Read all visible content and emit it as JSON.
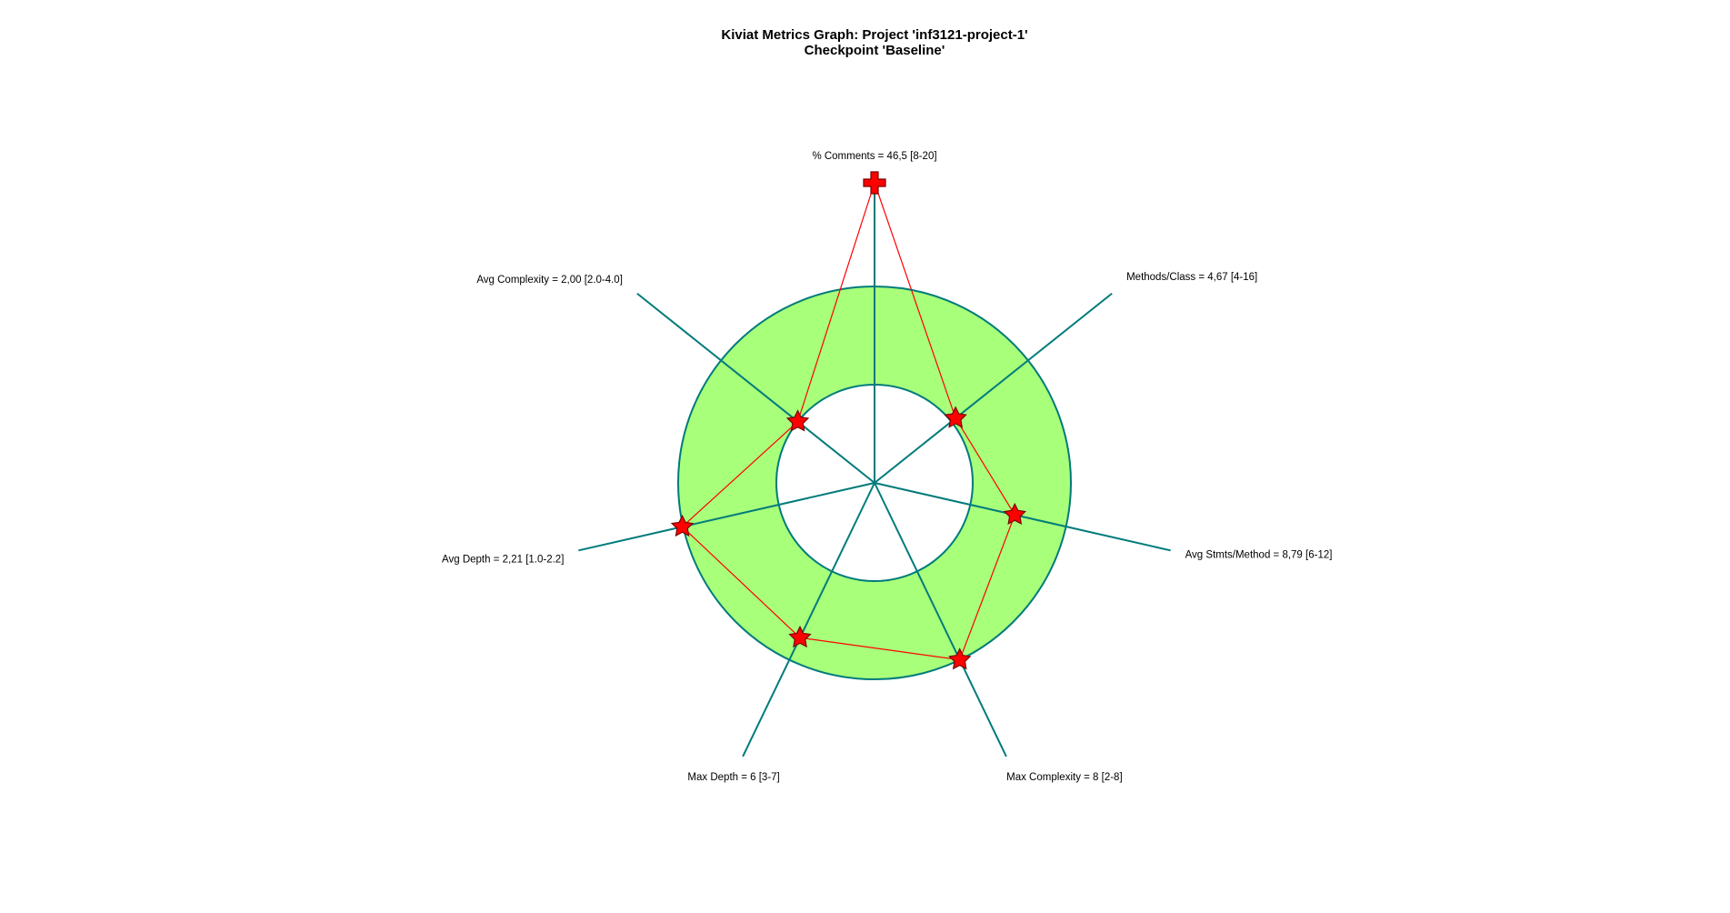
{
  "chart_data": {
    "type": "radar",
    "title": "Kiviat Metrics Graph: Project 'inf3121-project-1'",
    "subtitle": "Checkpoint 'Baseline'",
    "colors": {
      "axis": "#007b7b",
      "band_fill": "#a8ff7a",
      "band_stroke": "#007b7b",
      "polygon": "#ff0000",
      "marker_fill": "#ff0000",
      "marker_stroke": "#7a0000"
    },
    "axes": [
      {
        "metric": "% Comments",
        "value": 46.5,
        "range": [
          8,
          20
        ],
        "label": "% Comments = 46,5 [8-20]",
        "marker": "cross"
      },
      {
        "metric": "Methods/Class",
        "value": 4.67,
        "range": [
          4,
          16
        ],
        "label": "Methods/Class = 4,67 [4-16]",
        "marker": "star"
      },
      {
        "metric": "Avg Stmts/Method",
        "value": 8.79,
        "range": [
          6,
          12
        ],
        "label": "Avg Stmts/Method = 8,79 [6-12]",
        "marker": "star"
      },
      {
        "metric": "Max Complexity",
        "value": 8,
        "range": [
          2,
          8
        ],
        "label": "Max Complexity = 8 [2-8]",
        "marker": "star"
      },
      {
        "metric": "Max Depth",
        "value": 6,
        "range": [
          3,
          7
        ],
        "label": "Max Depth = 6 [3-7]",
        "marker": "star"
      },
      {
        "metric": "Avg Depth",
        "value": 2.21,
        "range": [
          1.0,
          2.2
        ],
        "label": "Avg Depth = 2,21 [1.0-2.2]",
        "marker": "star"
      },
      {
        "metric": "Avg Complexity",
        "value": 2.0,
        "range": [
          2.0,
          4.0
        ],
        "label": "Avg Complexity = 2,00 [2.0-4.0]",
        "marker": "star"
      }
    ]
  }
}
